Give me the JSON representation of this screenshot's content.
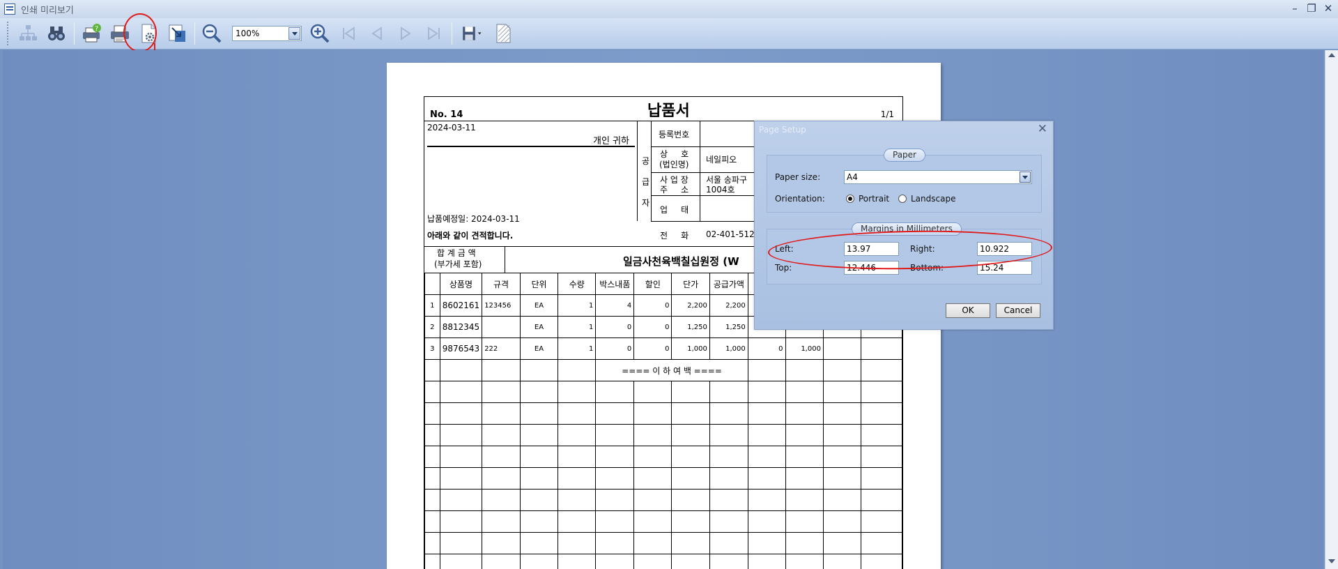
{
  "window": {
    "title": "인쇄 미리보기"
  },
  "toolbar": {
    "zoom_value": "100%",
    "buttons": [
      "tree",
      "find",
      "print-setup",
      "print",
      "page-setup",
      "scale",
      "zoom-out",
      "zoom-in",
      "first-page",
      "prev-page",
      "next-page",
      "last-page",
      "export",
      "watermark"
    ]
  },
  "dialog": {
    "title": "Page Setup",
    "paper_group": "Paper",
    "paper_size_label": "Paper size:",
    "paper_size_value": "A4",
    "orientation_label": "Orientation:",
    "portrait": "Portrait",
    "landscape": "Landscape",
    "orientation_selected": "Portrait",
    "margins_group": "Margins in Millimeters",
    "left_label": "Left:",
    "left_value": "13.97",
    "right_label": "Right:",
    "right_value": "10.922",
    "top_label": "Top:",
    "top_value": "12.446",
    "bottom_label": "Bottom:",
    "bottom_value": "15.24",
    "ok": "OK",
    "cancel": "Cancel"
  },
  "document": {
    "no": "No. 14",
    "title": "납품서",
    "page": "1/1",
    "date": "2024-03-11",
    "recipient": "개인 귀하",
    "delivery_date": "납품예정일: 2024-03-11",
    "note": "아래와 같이 견적합니다.",
    "supplier_vertical": [
      "공",
      "급",
      "자"
    ],
    "reg_no_label": "등록번호",
    "company_label_1": "상     호",
    "company_label_2": "(법인명)",
    "company_value": "네일피오",
    "address_label_1": "사 업 장",
    "address_label_2": "주     소",
    "address_value_1": "서울 송파구",
    "address_value_2": "1004호",
    "business_label": "업     태",
    "phone_label": "전     화",
    "phone_value": "02-401-512",
    "total_label_1": "합 계 금 액",
    "total_label_2": "(부가세 포함)",
    "total_value": "일금사천육백칠십원정  (W",
    "columns": [
      "",
      "상품명",
      "규격",
      "단위",
      "수량",
      "박스내품",
      "할인",
      "단가",
      "공급가액",
      "",
      "",
      "",
      ""
    ],
    "rows": [
      [
        "1",
        "8602161",
        "123456",
        "EA",
        "1",
        "4",
        "0",
        "2,200",
        "2,200",
        "",
        "",
        "",
        ""
      ],
      [
        "2",
        "8812345",
        "",
        "EA",
        "1",
        "0",
        "0",
        "1,250",
        "1,250",
        "",
        "",
        "",
        ""
      ],
      [
        "3",
        "9876543",
        "222",
        "EA",
        "1",
        "0",
        "0",
        "1,000",
        "1,000",
        "0",
        "1,000",
        "",
        ""
      ]
    ],
    "blank_marker": "==== 이 하 여 백 ===="
  }
}
